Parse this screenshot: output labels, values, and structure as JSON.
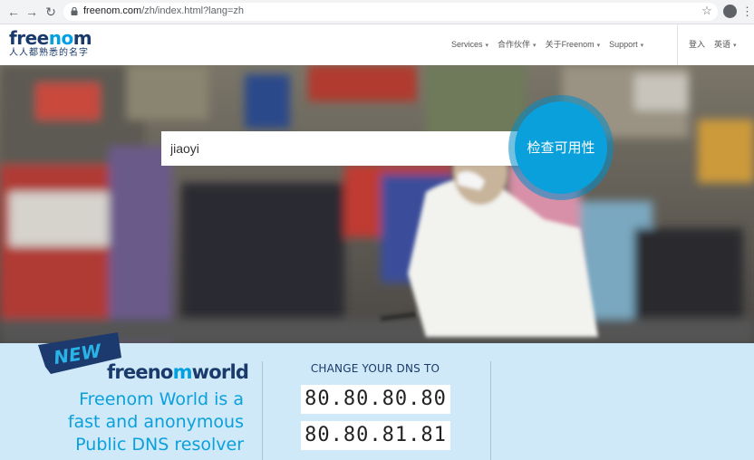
{
  "browser": {
    "back_icon": "arrow-left-icon",
    "forward_icon": "arrow-right-icon",
    "reload_icon": "reload-icon",
    "url_host": "freenom.com",
    "url_path": "/zh/index.html?lang=zh",
    "star_icon": "star-icon",
    "account_icon": "account-icon",
    "menu_icon": "kebab-menu-icon"
  },
  "header": {
    "logo_prefix": "free",
    "logo_accent": "no",
    "logo_suffix": "m",
    "tagline": "人人都熟悉的名字",
    "nav": [
      {
        "label": "Services"
      },
      {
        "label": "合作伙伴"
      },
      {
        "label": "关于Freenom"
      },
      {
        "label": "Support"
      }
    ],
    "login": "登入",
    "language": "英语"
  },
  "hero": {
    "search_value": "jiaoyi",
    "check_button": "检查可用性"
  },
  "promo": {
    "badge": "NEW",
    "world_logo_prefix": "freeno",
    "world_logo_accent": "m",
    "world_logo_suffix": "world",
    "headline_lines": [
      "Freenom World is a",
      "fast and anonymous",
      "Public DNS resolver"
    ],
    "dns_heading": "CHANGE YOUR DNS TO",
    "dns_primary": "80.80.80.80",
    "dns_secondary": "80.80.81.81"
  },
  "colors": {
    "brand_navy": "#1a3a6b",
    "brand_blue": "#00a0e3",
    "promo_background": "#cfe9f8"
  }
}
